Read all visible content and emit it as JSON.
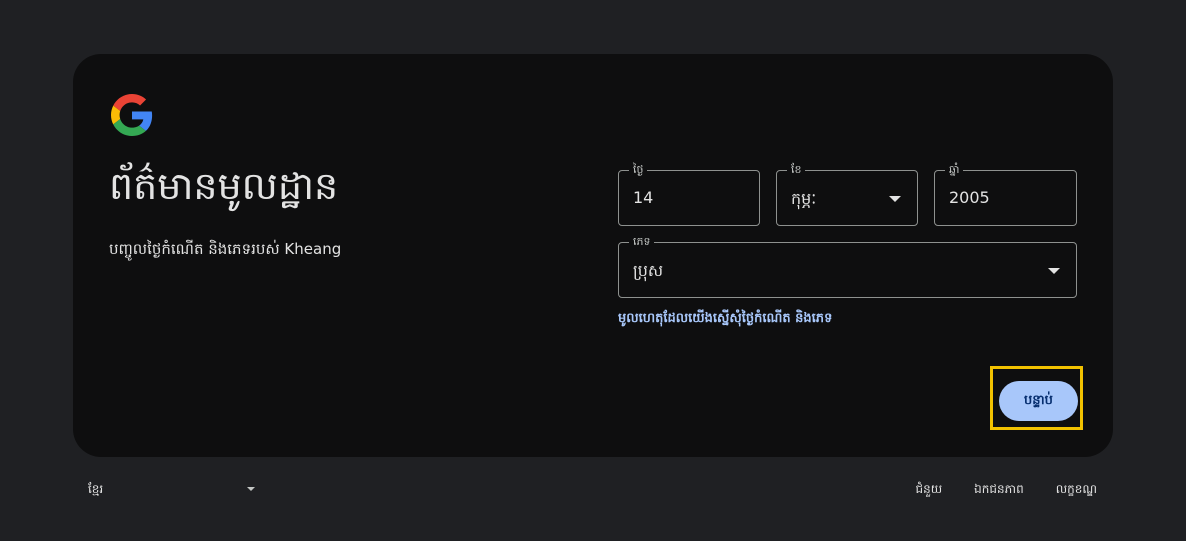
{
  "heading": {
    "title": "ព័ត៌មានមូលដ្ឋាន",
    "subtitle": "បញ្ចូលថ្ងៃកំណើត និងភេទរបស់ Kheang"
  },
  "form": {
    "day": {
      "label": "ថ្ងៃ",
      "value": "14"
    },
    "month": {
      "label": "ខែ",
      "value": "កុម្ភៈ"
    },
    "year": {
      "label": "ឆ្នាំ",
      "value": "2005"
    },
    "gender": {
      "label": "ភេទ",
      "value": "ប្រុស"
    },
    "why_link": "មូលហេតុដែលយើងស្នើសុំថ្ងៃកំណើត និងភេទ"
  },
  "actions": {
    "next_label": "បន្ទាប់"
  },
  "footer": {
    "language": "ខ្មែរ",
    "links": {
      "help": "ជំនួយ",
      "privacy": "ឯកជនភាព",
      "terms": "លក្ខខណ្ឌ"
    }
  },
  "colors": {
    "card_bg": "#0e0e0f",
    "page_bg": "#1f2023",
    "accent": "#a8c7fa",
    "highlight": "#f2c200"
  },
  "icons": {
    "logo": "google-g-logo",
    "dropdown": "caret-down-icon"
  }
}
